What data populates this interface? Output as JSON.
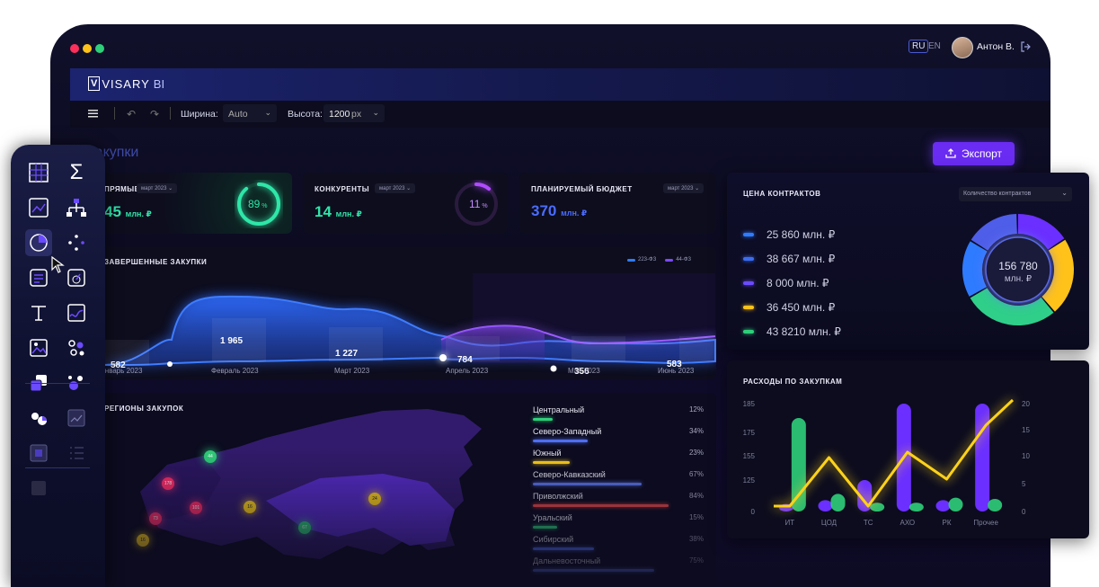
{
  "window": {
    "lang_active": "RU",
    "lang_other": "EN",
    "user_name": "Антон В."
  },
  "app": {
    "logo": "VISARY",
    "logo_suffix": "BI"
  },
  "toolbar": {
    "width_label": "Ширина:",
    "width_value": "Auto",
    "height_label": "Высота:",
    "height_value": "1200",
    "height_unit": "px"
  },
  "page": {
    "title": "Закупки",
    "export_label": "Экспорт"
  },
  "kpi": [
    {
      "title": "ПРЯМЫЕ",
      "chip": "март 2023",
      "value": "45",
      "unit": "млн. ₽",
      "percent": "89",
      "ring_fraction": 0.89,
      "color": "#2ee6a8"
    },
    {
      "title": "КОНКУРЕНТЫ",
      "chip": "март 2023",
      "value": "14",
      "unit": "млн. ₽",
      "percent": "11",
      "ring_fraction": 0.11,
      "color": "#b14bff"
    },
    {
      "title": "ПЛАНИРУЕМЫЙ БЮДЖЕТ",
      "chip": "март 2023",
      "value": "370",
      "unit": "млн. ₽"
    }
  ],
  "completed": {
    "title": "ЗАВЕРШЕННЫЕ ЗАКУПКИ",
    "legend": [
      {
        "name": "223-ФЗ",
        "color": "#2f7bff"
      },
      {
        "name": "44-ФЗ",
        "color": "#7b4bff"
      }
    ],
    "months": [
      "Январь 2023",
      "Февраль 2023",
      "Март 2023",
      "Апрель 2023",
      "Май 2023",
      "Июнь 2023"
    ],
    "labels": [
      "582",
      "1 965",
      "1 227",
      "784",
      "356",
      "583"
    ]
  },
  "contracts": {
    "title": "ЦЕНА КОНТРАКТОВ",
    "select": "Количество контрактов",
    "items": [
      {
        "value": "25 860 млн. ₽",
        "color": "#2f7bff"
      },
      {
        "value": "38 667 млн. ₽",
        "color": "#3c6df0"
      },
      {
        "value": "8 000 млн. ₽",
        "color": "#6b4bff"
      },
      {
        "value": "36 450 млн. ₽",
        "color": "#ffc21a"
      },
      {
        "value": "43 8210 млн. ₽",
        "color": "#2fcf7a"
      }
    ],
    "donut_total": "156 780",
    "donut_unit": "млн. ₽",
    "donut_segments": [
      {
        "value": 16,
        "color": "#6b2fff"
      },
      {
        "value": 23,
        "color": "#ffc21a"
      },
      {
        "value": 28,
        "color": "#2fcf8a"
      },
      {
        "value": 17,
        "color": "#2f7bff"
      },
      {
        "value": 16,
        "color": "#4f5ee8"
      }
    ]
  },
  "regions": {
    "title": "РЕГИОНЫ ЗАКУПОК",
    "items": [
      {
        "name": "Центральный",
        "pct": "12%",
        "fill": 0.12,
        "color": "#2fcf7a"
      },
      {
        "name": "Северо-Западный",
        "pct": "34%",
        "fill": 0.34,
        "color": "#4f6ef0"
      },
      {
        "name": "Южный",
        "pct": "23%",
        "fill": 0.23,
        "color": "#ffd21a"
      },
      {
        "name": "Северо-Кавказский",
        "pct": "67%",
        "fill": 0.67,
        "color": "#5b73e8"
      },
      {
        "name": "Приволжский",
        "pct": "84%",
        "fill": 0.84,
        "color": "#e84a4a"
      },
      {
        "name": "Уральский",
        "pct": "15%",
        "fill": 0.15,
        "color": "#2fcf7a"
      },
      {
        "name": "Сибирский",
        "pct": "38%",
        "fill": 0.38,
        "color": "#4f6ef0"
      },
      {
        "name": "Дальневосточный",
        "pct": "75%",
        "fill": 0.75,
        "color": "#5b73e8"
      }
    ],
    "markers": [
      {
        "label": "178",
        "color": "#ff2f6b"
      },
      {
        "label": "44",
        "color": "#2fcf7a"
      },
      {
        "label": "101",
        "color": "#ff2f6b"
      },
      {
        "label": "73",
        "color": "#ff2f6b"
      },
      {
        "label": "16",
        "color": "#ffd21a"
      },
      {
        "label": "24",
        "color": "#ffd21a"
      },
      {
        "label": "67",
        "color": "#2fcf7a"
      },
      {
        "label": "16",
        "color": "#ffd21a"
      }
    ]
  },
  "expenses": {
    "title": "РАСХОДЫ ПО ЗАКУПКАМ",
    "chart_data": {
      "type": "bar",
      "categories": [
        "ИТ",
        "ЦОД",
        "ТС",
        "АХО",
        "РК",
        "Прочее"
      ],
      "series": [
        {
          "values": [
            30,
            45,
            125,
            185,
            45,
            185
          ],
          "color": "#6b2fff"
        },
        {
          "values": [
            180,
            70,
            35,
            35,
            55,
            50
          ],
          "color": "#2fcf7a"
        }
      ],
      "line": {
        "values": [
          1,
          10,
          1,
          11,
          6,
          16
        ],
        "color": "#ffd21a"
      },
      "y_left": {
        "ticks": [
          "0",
          "25",
          "55",
          "125",
          "155",
          "175",
          "185"
        ],
        "range": [
          0,
          185
        ]
      },
      "y_right": {
        "ticks": [
          "0",
          "5",
          "10",
          "15",
          "20"
        ],
        "range": [
          0,
          20
        ]
      }
    }
  },
  "tools": [
    "grid-icon",
    "sum-icon",
    "line-chart-icon",
    "hierarchy-icon",
    "pie-chart-icon",
    "scatter-icon",
    "text-block-icon",
    "gauge-icon",
    "text-icon",
    "sparkline-icon",
    "image-icon",
    "bubbles-icon",
    "layers-icon",
    "dots-icon",
    "shapes-icon",
    "box-chart-icon",
    "plus-box-icon",
    "list-icon",
    "square-icon"
  ]
}
